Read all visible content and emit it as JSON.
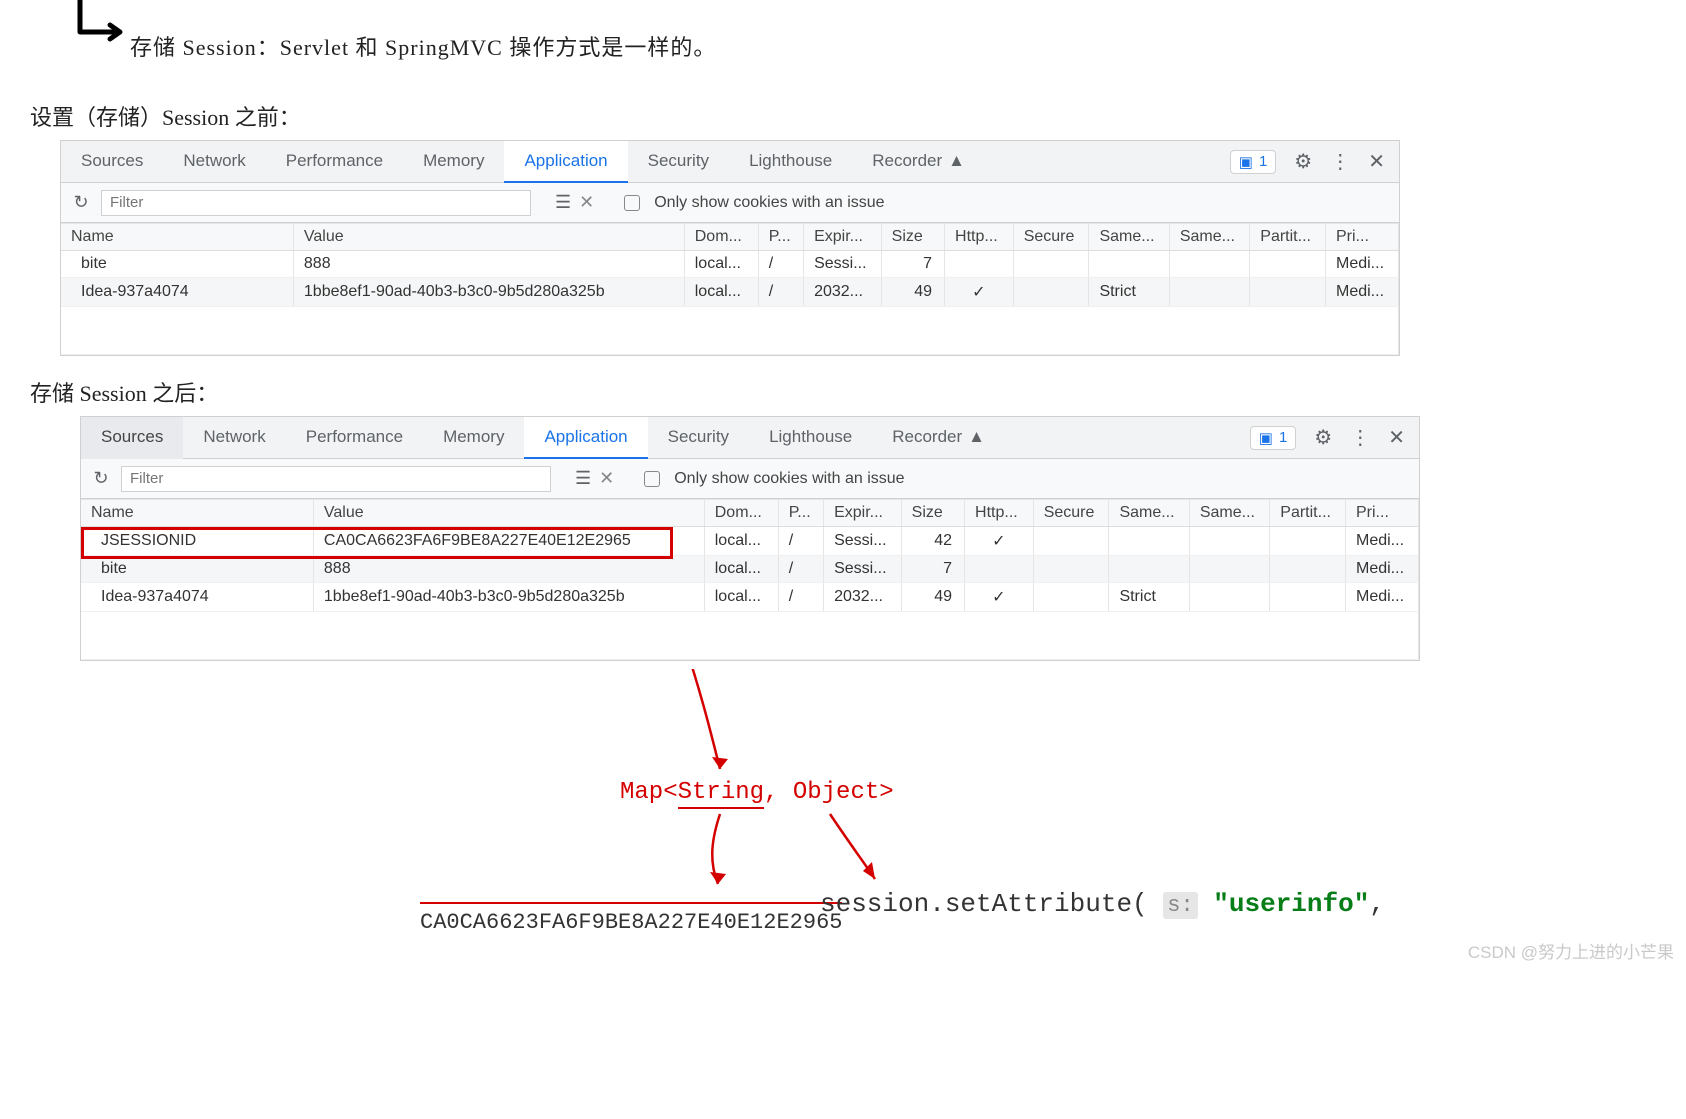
{
  "handnote": "存储 Session：Servlet 和 SpringMVC 操作方式是一样的。",
  "heading_before": "设置（存储）Session 之前：",
  "heading_after": "存储 Session 之后：",
  "tabs": [
    "Sources",
    "Network",
    "Performance",
    "Memory",
    "Application",
    "Security",
    "Lighthouse",
    "Recorder"
  ],
  "active_tab": "Application",
  "chat_count": "1",
  "filter_placeholder": "Filter",
  "only_issue_label": "Only show cookies with an issue",
  "columns": [
    "Name",
    "Value",
    "Dom...",
    "P...",
    "Expir...",
    "Size",
    "Http...",
    "Secure",
    "Same...",
    "Same...",
    "Partit...",
    "Pri..."
  ],
  "before_rows": [
    {
      "name": "bite",
      "value": "888",
      "dom": "local...",
      "path": "/",
      "exp": "Sessi...",
      "size": "7",
      "http": "",
      "secure": "",
      "same1": "",
      "same2": "",
      "part": "",
      "pri": "Medi..."
    },
    {
      "name": "Idea-937a4074",
      "value": "1bbe8ef1-90ad-40b3-b3c0-9b5d280a325b",
      "dom": "local...",
      "path": "/",
      "exp": "2032...",
      "size": "49",
      "http": "✓",
      "secure": "",
      "same1": "Strict",
      "same2": "",
      "part": "",
      "pri": "Medi..."
    }
  ],
  "after_rows": [
    {
      "name": "JSESSIONID",
      "value": "CA0CA6623FA6F9BE8A227E40E12E2965",
      "dom": "local...",
      "path": "/",
      "exp": "Sessi...",
      "size": "42",
      "http": "✓",
      "secure": "",
      "same1": "",
      "same2": "",
      "part": "",
      "pri": "Medi..."
    },
    {
      "name": "bite",
      "value": "888",
      "dom": "local...",
      "path": "/",
      "exp": "Sessi...",
      "size": "7",
      "http": "",
      "secure": "",
      "same1": "",
      "same2": "",
      "part": "",
      "pri": "Medi..."
    },
    {
      "name": "Idea-937a4074",
      "value": "1bbe8ef1-90ad-40b3-b3c0-9b5d280a325b",
      "dom": "local...",
      "path": "/",
      "exp": "2032...",
      "size": "49",
      "http": "✓",
      "secure": "",
      "same1": "Strict",
      "same2": "",
      "part": "",
      "pri": "Medi..."
    }
  ],
  "anno": {
    "map_text_1": "Map<",
    "map_text_2": "String",
    "map_text_3": ", Object>",
    "hash_repeat": "CA0CA6623FA6F9BE8A227E40E12E2965",
    "code_prefix": "session.setAttribute(",
    "code_hint": "s:",
    "code_string": "\"userinfo\"",
    "code_suffix": ","
  },
  "watermark": "CSDN @努力上进的小芒果"
}
